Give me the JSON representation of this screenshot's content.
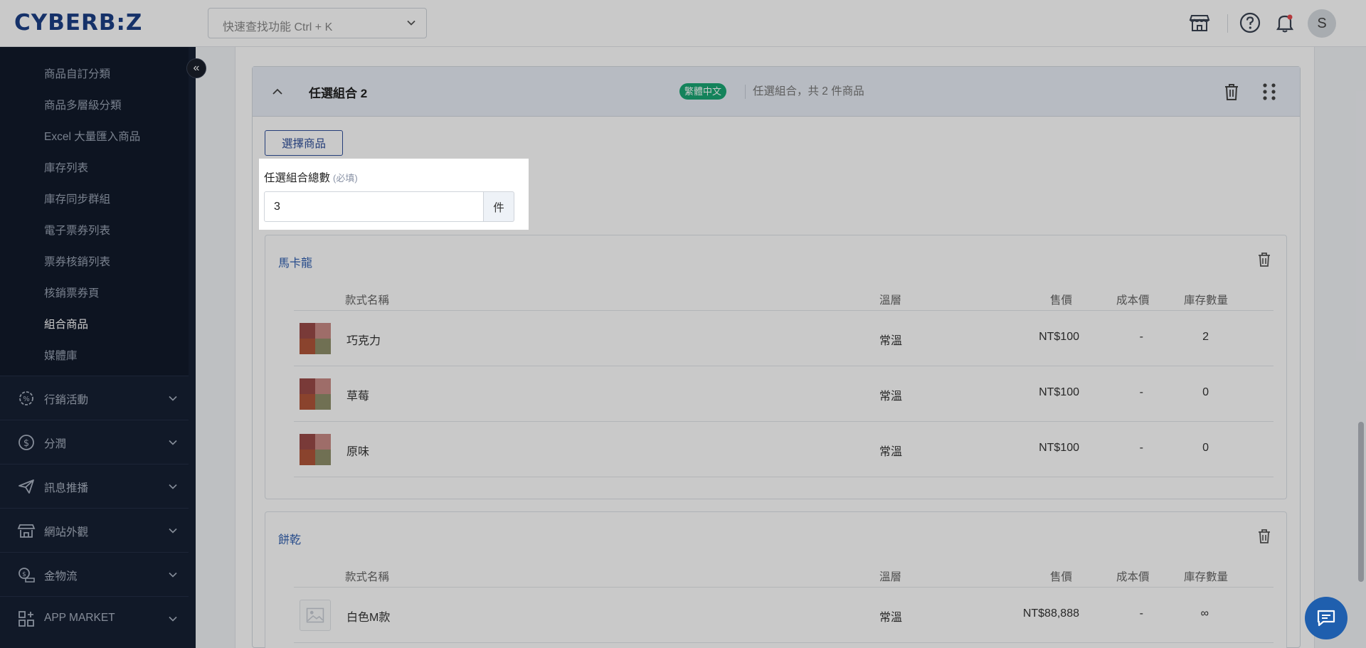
{
  "brand": {
    "logo": "CYBERB:Z"
  },
  "topbar": {
    "search_placeholder": "快速查找功能 Ctrl + K",
    "avatar_initial": "S"
  },
  "sidebar": {
    "sub_items": [
      {
        "label": "商品自訂分類"
      },
      {
        "label": "商品多層級分類"
      },
      {
        "label": "Excel 大量匯入商品"
      },
      {
        "label": "庫存列表"
      },
      {
        "label": "庫存同步群組"
      },
      {
        "label": "電子票券列表"
      },
      {
        "label": "票券核銷列表"
      },
      {
        "label": "核銷票券頁"
      },
      {
        "label": "組合商品",
        "active": true
      },
      {
        "label": "媒體庫"
      }
    ],
    "groups": [
      {
        "label": "行銷活動",
        "icon": "marketing-gear-icon"
      },
      {
        "label": "分潤",
        "icon": "profit-share-icon"
      },
      {
        "label": "訊息推播",
        "icon": "paper-plane-icon"
      },
      {
        "label": "網站外觀",
        "icon": "storefront-icon"
      },
      {
        "label": "金物流",
        "icon": "payment-logistics-icon"
      },
      {
        "label": "APP MARKET",
        "icon": "app-grid-icon"
      }
    ],
    "collapse_glyph": "«"
  },
  "combo": {
    "title": "任選組合 2",
    "language_badge": "繁體中文",
    "description": "任選組合，共 2 件商品",
    "select_button": "選擇商品",
    "total_label": "任選組合總數",
    "total_required": "(必填)",
    "total_value": "3",
    "total_unit": "件",
    "columns": {
      "name": "款式名稱",
      "temp": "溫層",
      "price": "售價",
      "cost": "成本價",
      "stock": "庫存數量"
    },
    "groups": [
      {
        "name": "馬卡龍",
        "rows": [
          {
            "name": "巧克力",
            "temp": "常溫",
            "price": "NT$100",
            "cost": "-",
            "stock": "2"
          },
          {
            "name": "草莓",
            "temp": "常溫",
            "price": "NT$100",
            "cost": "-",
            "stock": "0"
          },
          {
            "name": "原味",
            "temp": "常溫",
            "price": "NT$100",
            "cost": "-",
            "stock": "0"
          }
        ]
      },
      {
        "name": "餅乾",
        "rows": [
          {
            "name": "白色M款",
            "temp": "常溫",
            "price": "NT$88,888",
            "cost": "-",
            "stock": "∞"
          }
        ]
      }
    ]
  },
  "colors": {
    "brand": "#1b3f86",
    "sidebar_bg": "#162033",
    "badge_green": "#1aa774",
    "link_blue": "#2f5fb0",
    "chat_blue": "#1f5fae"
  }
}
